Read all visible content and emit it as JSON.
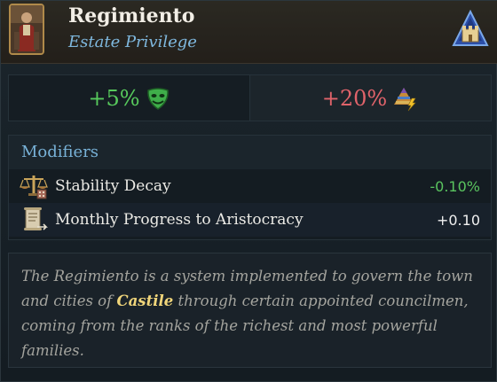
{
  "header": {
    "title": "Regimiento",
    "subtitle": "Estate Privilege"
  },
  "effects": [
    {
      "value": "+5%",
      "icon": "mask-icon",
      "color": "#57c95c"
    },
    {
      "value": "+20%",
      "icon": "pyramid-lightning-icon",
      "color": "#e0636a"
    }
  ],
  "modifiers": {
    "heading": "Modifiers",
    "rows": [
      {
        "label": "Stability Decay",
        "value": "-0.10%",
        "icon": "scales-icon",
        "color": "#5ac45f"
      },
      {
        "label": "Monthly Progress to Aristocracy",
        "value": "+0.10",
        "icon": "scroll-icon",
        "color": "#f0f0f0"
      }
    ]
  },
  "description": {
    "before": "The Regimiento is a system implemented to govern the town and cities of ",
    "highlight": "Castile",
    "after": " through certain appointed councilmen, coming from the ranks of the richest and most powerful families."
  }
}
